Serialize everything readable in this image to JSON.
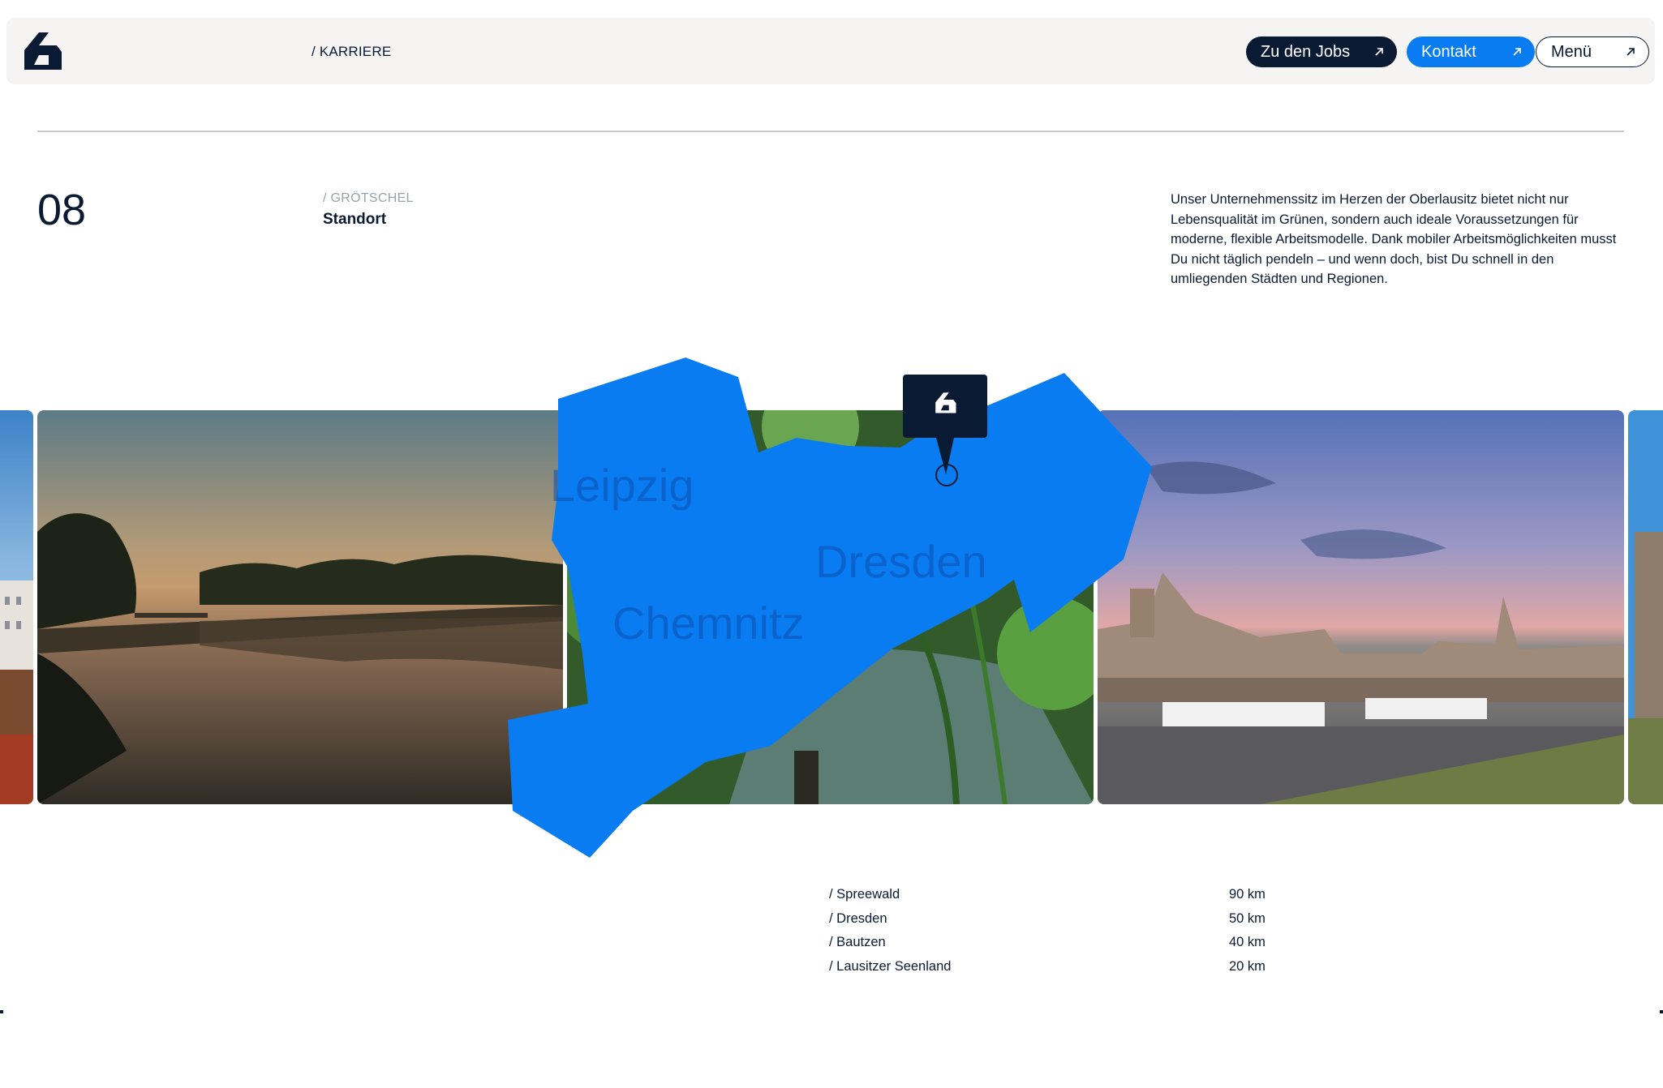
{
  "header": {
    "breadcrumb": "/ KARRIERE",
    "buttons": {
      "jobs": "Zu den Jobs",
      "kontakt": "Kontakt",
      "menu": "Menü"
    }
  },
  "section": {
    "number": "08",
    "kicker": "/ GRÖTSCHEL",
    "title": "Standort",
    "text": "Unser Unternehmenssitz im Herzen der Oberlausitz bietet nicht nur Lebensqualität im Grünen, sondern auch ideale Voraussetzungen für moderne, flexible Arbeitsmodelle. Dank mobiler Arbeitsmöglichkeiten musst Du nicht täglich pendeln – und wenn doch, bist Du schnell in den umliegenden Städten und Regionen."
  },
  "map": {
    "cities": [
      "Leipzig",
      "Dresden",
      "Chemnitz"
    ]
  },
  "distances": [
    {
      "place": "/ Spreewald",
      "km": "90 km"
    },
    {
      "place": "/ Dresden",
      "km": "50 km"
    },
    {
      "place": "/ Bautzen",
      "km": "40 km"
    },
    {
      "place": "/ Lausitzer Seenland",
      "km": "20 km"
    }
  ],
  "colors": {
    "navy": "#0b1a33",
    "accent_blue": "#0a7cf1",
    "header_bg": "#f5f4f2"
  },
  "icons": {
    "logo": "brand-logo-icon",
    "arrow": "arrow-up-right-icon",
    "marker": "location-pin-icon"
  }
}
